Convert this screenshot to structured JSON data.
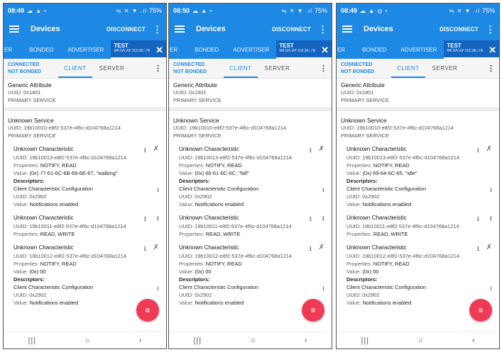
{
  "phones": [
    {
      "status": {
        "time": "08:49",
        "left_icons": "☁ ▲ •",
        "right_icons": "⇆ ✕ ▼ .ıl",
        "battery": "75%"
      },
      "appbar": {
        "title": "Devices",
        "disconnect": "DISCONNECT"
      },
      "tabs": {
        "partial": "ER",
        "bonded": "BONDED",
        "advertiser": "ADVERTISER",
        "device": "TEST",
        "address": "94:0A:AF:03:3E:76"
      },
      "conn": {
        "connected": "CONNECTED",
        "bonded": "NOT BONDED",
        "client": "CLIENT",
        "server": "SERVER"
      },
      "generic": {
        "name": "Generic Attribute",
        "uuid": "UUID: 0x1801",
        "type": "PRIMARY SERVICE"
      },
      "service": {
        "name": "Unknown Service",
        "uuid": "UUID: 19b10010-e8f2-537e-4f6c-d104768a1214",
        "type": "PRIMARY SERVICE"
      },
      "chars": [
        {
          "name": "Unknown Characteristic",
          "uuid": "UUID: 19b10013-e8f2-537e-4f6c-d104768a1214",
          "props_k": "Properties: ",
          "props_v": "NOTIFY, READ",
          "value_k": "Value: ",
          "value_v": "(0x) 77-61-6C-6B-69-6E-67, \"walking\"",
          "desc_h": "Descriptors:",
          "desc_name": "Client Characteristic Configuration",
          "desc_uuid": "UUID: 0x2902",
          "desc_value_k": "Value: ",
          "desc_value_v": "Notifications enabled"
        },
        {
          "name": "Unknown Characteristic",
          "uuid": "UUID: 19b10011-e8f2-537e-4f6c-d104768a1214",
          "props_k": "Properties: ",
          "props_v": "READ, WRITE"
        },
        {
          "name": "Unknown Characteristic",
          "uuid": "UUID: 19b10012-e8f2-537e-4f6c-d104768a1214",
          "props_k": "Properties: ",
          "props_v": "NOTIFY, READ",
          "value_k": "Value: ",
          "value_v": "(0x) 00",
          "desc_h": "Descriptors:",
          "desc_name": "Client Characteristic Configuration",
          "desc_uuid": "UUID: 0x2902",
          "desc_value_k": "Value: ",
          "desc_value_v": "Notifications enabled"
        }
      ]
    },
    {
      "status": {
        "time": "08:50",
        "left_icons": "☁ ▲ •",
        "right_icons": "⇆ ✕ ▼ .ıl",
        "battery": "75%"
      },
      "appbar": {
        "title": "Devices",
        "disconnect": "DISCONNECT"
      },
      "tabs": {
        "partial": "ER",
        "bonded": "BONDED",
        "advertiser": "ADVERTISER",
        "device": "TEST",
        "address": "94:0A:AF:03:3E:76"
      },
      "conn": {
        "connected": "CONNECTED",
        "bonded": "NOT BONDED",
        "client": "CLIENT",
        "server": "SERVER"
      },
      "generic": {
        "name": "Generic Attribute",
        "uuid": "UUID: 0x1801",
        "type": "PRIMARY SERVICE"
      },
      "service": {
        "name": "Unknown Service",
        "uuid": "UUID: 19b10010-e8f2-537e-4f6c-d104768a1214",
        "type": "PRIMARY SERVICE"
      },
      "chars": [
        {
          "name": "Unknown Characteristic",
          "uuid": "UUID: 19b10013-e8f2-537e-4f6c-d104768a1214",
          "props_k": "Properties: ",
          "props_v": "NOTIFY, READ",
          "value_k": "Value: ",
          "value_v": "(0x) 66-61-6C-6C, \"fall\"",
          "desc_h": "Descriptors:",
          "desc_name": "Client Characteristic Configuration",
          "desc_uuid": "UUID: 0x2902",
          "desc_value_k": "Value: ",
          "desc_value_v": "Notifications enabled"
        },
        {
          "name": "Unknown Characteristic",
          "uuid": "UUID: 19b10011-e8f2-537e-4f6c-d104768a1214",
          "props_k": "Properties: ",
          "props_v": "READ, WRITE"
        },
        {
          "name": "Unknown Characteristic",
          "uuid": "UUID: 19b10012-e8f2-537e-4f6c-d104768a1214",
          "props_k": "Properties: ",
          "props_v": "NOTIFY, READ",
          "value_k": "Value: ",
          "value_v": "(0x) 00",
          "desc_h": "Descriptors:",
          "desc_name": "Client Characteristic Configuration",
          "desc_uuid": "UUID: 0x2902",
          "desc_value_k": "Value: ",
          "desc_value_v": "Notifications enabled"
        }
      ]
    },
    {
      "status": {
        "time": "08:49",
        "left_icons": "☁ ▲ ◎ •",
        "right_icons": "⇆ ✕ ▼ .ıl",
        "battery": "75%"
      },
      "appbar": {
        "title": "Devices",
        "disconnect": "DISCONNECT"
      },
      "tabs": {
        "partial": "ER",
        "bonded": "BONDED",
        "advertiser": "ADVERTISER",
        "device": "TEST",
        "address": "94:0A:AF:03:3E:76"
      },
      "conn": {
        "connected": "CONNECTED",
        "bonded": "NOT BONDED",
        "client": "CLIENT",
        "server": "SERVER"
      },
      "generic": {
        "name": "Generic Attribute",
        "uuid": "UUID: 0x1801",
        "type": "PRIMARY SERVICE"
      },
      "service": {
        "name": "Unknown Service",
        "uuid": "UUID: 19b10010-e8f2-537e-4f6c-d104768a1214",
        "type": "PRIMARY SERVICE"
      },
      "chars": [
        {
          "name": "Unknown Characteristic",
          "uuid": "UUID: 19b10013-e8f2-537e-4f6c-d104768a1214",
          "props_k": "Properties: ",
          "props_v": "NOTIFY, READ",
          "value_k": "Value: ",
          "value_v": "(0x) 69-64-6C-65, \"idle\"",
          "desc_h": "Descriptors:",
          "desc_name": "Client Characteristic Configuration",
          "desc_uuid": "UUID: 0x2902",
          "desc_value_k": "Value: ",
          "desc_value_v": "Notifications enabled"
        },
        {
          "name": "Unknown Characteristic",
          "uuid": "UUID: 19b10011-e8f2-537e-4f6c-d104768a1214",
          "props_k": "Properties: ",
          "props_v": "READ, WRITE"
        },
        {
          "name": "Unknown Characteristic",
          "uuid": "UUID: 19b10012-e8f2-537e-4f6c-d104768a1214",
          "props_k": "Properties: ",
          "props_v": "NOTIFY, READ",
          "value_k": "Value: ",
          "value_v": "(0x) 00",
          "desc_h": "Descriptors:",
          "desc_name": "Client Characteristic Configuration",
          "desc_uuid": "UUID: 0x2902",
          "desc_value_k": "Value: ",
          "desc_value_v": "Notifications enabled"
        }
      ]
    }
  ],
  "icons": {
    "download": "⭳",
    "upload": "⭱",
    "notify_off": "✗",
    "fab": "≡",
    "nav_recent": "|||",
    "nav_home": "○",
    "nav_back": "‹",
    "close": "✕",
    "more": "⋮"
  },
  "colors": {
    "primary": "#1e88e5",
    "primary_dark": "#1565c0",
    "fab": "#ef3a55"
  }
}
